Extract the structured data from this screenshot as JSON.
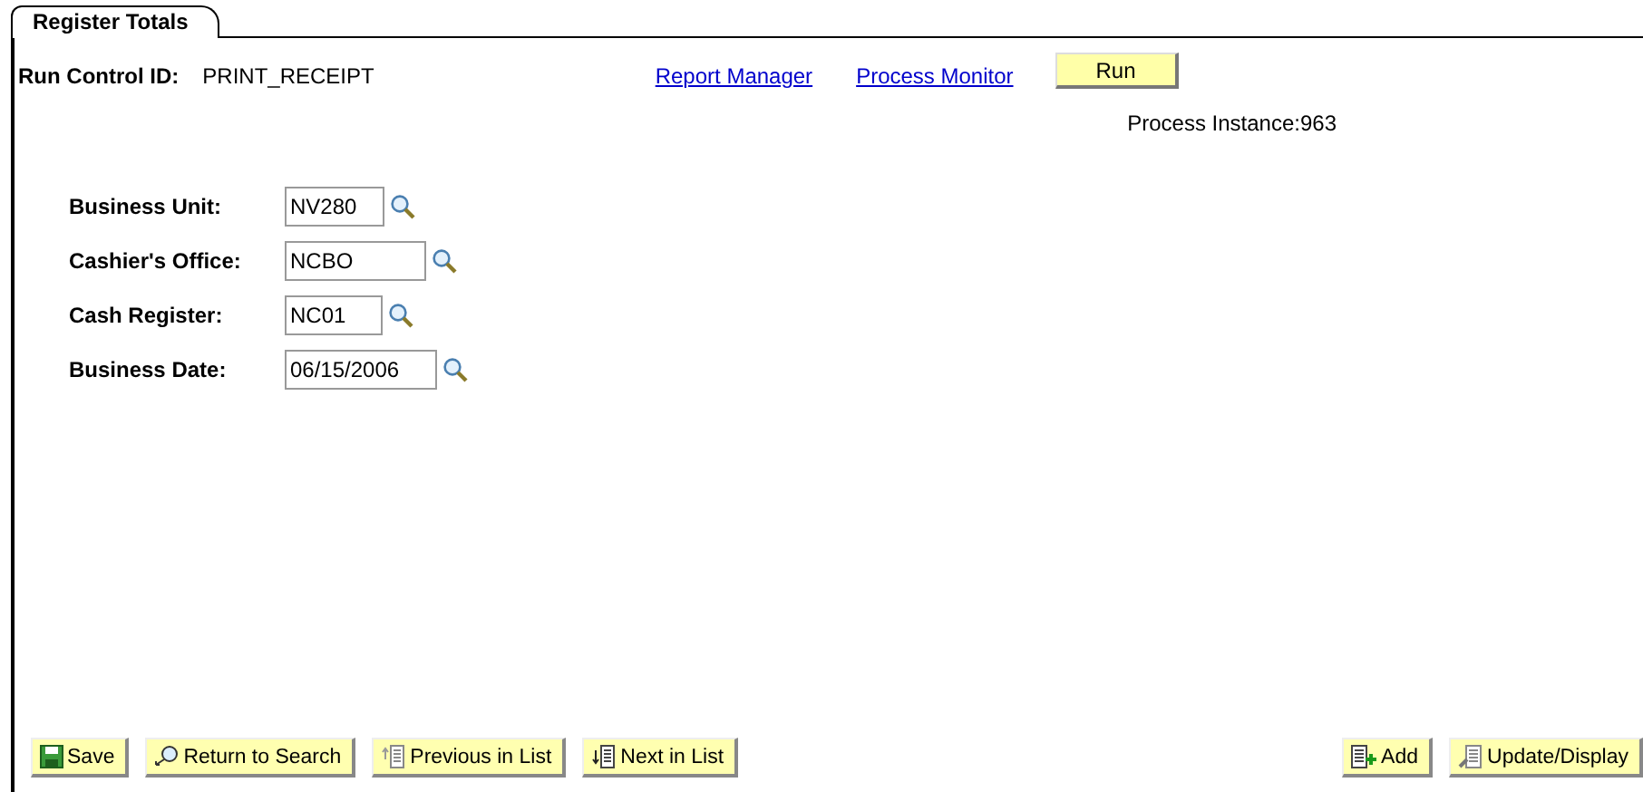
{
  "tabs": [
    {
      "label": "Register Totals",
      "selected": true
    }
  ],
  "run_control": {
    "label": "Run Control ID:",
    "value": "PRINT_RECEIPT"
  },
  "links": [
    "Report Manager",
    "Process Monitor"
  ],
  "run_button": "Run",
  "process_instance": "Process Instance:963",
  "fields": [
    {
      "label": "Business Unit:",
      "value": "NV280"
    },
    {
      "label": "Cashier's Office:",
      "value": "NCBO"
    },
    {
      "label": "Cash Register:",
      "value": "NC01"
    },
    {
      "label": "Business Date:",
      "value": "06/15/2006"
    }
  ],
  "left_buttons": [
    "Save",
    "Return to Search",
    "Previous in List",
    "Next in List"
  ],
  "right_buttons": [
    "Add",
    "Update/Display"
  ]
}
